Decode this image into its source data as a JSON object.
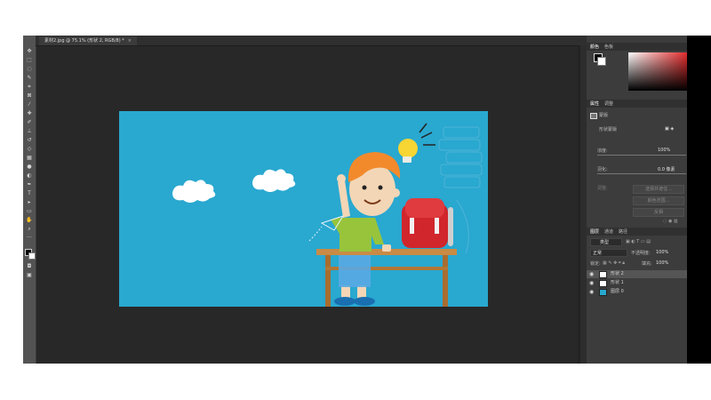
{
  "document_tab": {
    "title": "素材2.jpg @ 75.1% (形状 2, RGB/8) *",
    "close": "×"
  },
  "colors": {
    "canvas_bg": "#29a8d0",
    "panel_bg": "#3c3c3c",
    "workspace": "#282828"
  },
  "tools": [
    "move-tool",
    "marquee-tool",
    "lasso-tool",
    "quick-select-tool",
    "crop-tool",
    "frame-tool",
    "eyedropper-tool",
    "healing-tool",
    "brush-tool",
    "stamp-tool",
    "history-brush-tool",
    "eraser-tool",
    "gradient-tool",
    "blur-tool",
    "dodge-tool",
    "pen-tool",
    "type-tool",
    "path-select-tool",
    "shape-tool",
    "hand-tool",
    "zoom-tool",
    "more-tools"
  ],
  "color_panel": {
    "tabs": [
      "颜色",
      "色板"
    ]
  },
  "properties_panel": {
    "tabs": [
      "属性",
      "调整"
    ],
    "layer_type": "蒙版",
    "section": "形状蒙版",
    "density_label": "浓度:",
    "density_value": "100%",
    "feather_label": "羽化:",
    "feather_value": "0.0 像素",
    "adjust_label": "调整:",
    "select_mask_btn": "选择并遮住...",
    "color_range_btn": "颜色范围...",
    "invert_btn": "反相"
  },
  "layers_panel": {
    "tabs": [
      "图层",
      "通道",
      "路径"
    ],
    "filter": "类型",
    "blend_mode": "正常",
    "opacity_label": "不透明度:",
    "opacity_value": "100%",
    "lock_label": "锁定:",
    "fill_label": "填充:",
    "fill_value": "100%",
    "layers": [
      {
        "name": "形状 2",
        "selected": true
      },
      {
        "name": "形状 1",
        "selected": false
      },
      {
        "name": "图层 0",
        "selected": false
      }
    ]
  }
}
